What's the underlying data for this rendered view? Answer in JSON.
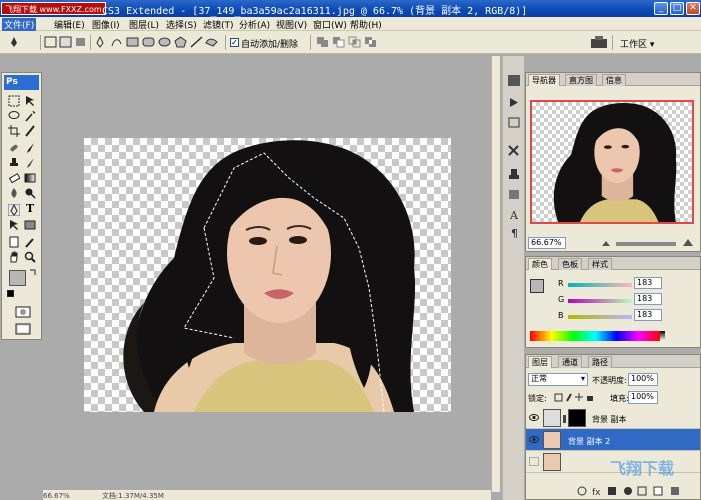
{
  "window": {
    "title": "CS3 Extended - [37_149_ba3a59ac2a16311.jpg @ 66.7% (背景 副本 2, RGB/8)]",
    "watermark": "飞翔下载 www.FXXZ.com"
  },
  "menu": [
    "文件(F)",
    "编辑(E)",
    "图像(I)",
    "图层(L)",
    "选择(S)",
    "滤镜(T)",
    "分析(A)",
    "视图(V)",
    "窗口(W)",
    "帮助(H)"
  ],
  "options": {
    "auto_add_delete": "自动添加/删除",
    "auto_add_delete_checked": true,
    "workspace": "工作区"
  },
  "toolbox": {
    "logo": "Ps",
    "type_tool": "T"
  },
  "navigator": {
    "tabs": [
      "导航器",
      "直方图",
      "信息"
    ],
    "zoom": "66.67%"
  },
  "color": {
    "tabs": [
      "颜色",
      "色板",
      "样式"
    ],
    "labels": [
      "R",
      "G",
      "B"
    ],
    "values": [
      "183",
      "183",
      "183"
    ]
  },
  "layers": {
    "tabs": [
      "图层",
      "通道",
      "路径"
    ],
    "blend_mode": "正常",
    "opacity_label": "不透明度:",
    "opacity": "100%",
    "lock_label": "锁定:",
    "fill_label": "填充:",
    "fill": "100%",
    "items": [
      {
        "name": "背景 副本",
        "selected": false
      },
      {
        "name": "背景 副本 2",
        "selected": true
      },
      {
        "name": "",
        "selected": false
      }
    ]
  },
  "status": {
    "zoom": "66.67%",
    "doc": "文档:1.37M/4.35M"
  },
  "watermark_bottom": "飞翔下载"
}
